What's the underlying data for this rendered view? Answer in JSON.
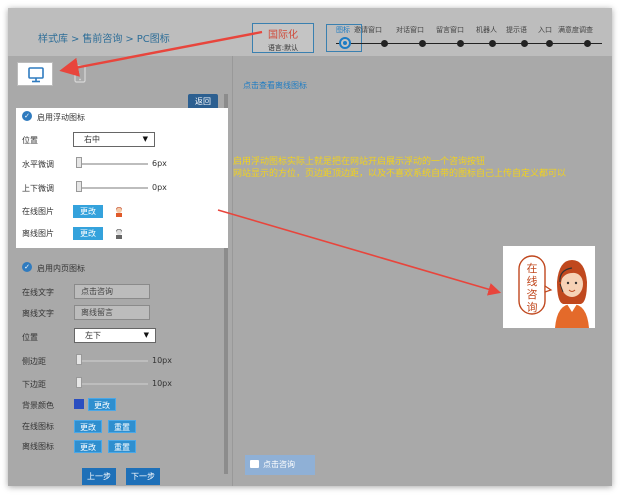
{
  "header": {
    "breadcrumb": [
      "样式库",
      "售前咨询",
      "PC图标"
    ],
    "breadcrumb_sep": ">",
    "intl": {
      "title": "国际化",
      "lang": "语言:默认"
    },
    "steps": [
      "图标",
      "邀请窗口",
      "对话窗口",
      "留言窗口",
      "机器人",
      "提示语",
      "入口",
      "满意度调查"
    ]
  },
  "left": {
    "back_label": "返回",
    "float_section": {
      "title": "启用浮动图标",
      "position_label": "位置",
      "position_value": "右中",
      "h_adjust_label": "水平微调",
      "h_adjust_value": "6px",
      "v_adjust_label": "上下微调",
      "v_adjust_value": "0px",
      "online_img_label": "在线图片",
      "offline_img_label": "离线图片",
      "change_label": "更改"
    },
    "inpage_section": {
      "title": "启用内页图标",
      "online_text_label": "在线文字",
      "online_text_value": "点击咨询",
      "offline_text_label": "离线文字",
      "offline_text_value": "离线留言",
      "position_label": "位置",
      "position_value": "左下",
      "side_margin_label": "侧边距",
      "side_margin_value": "10px",
      "bottom_margin_label": "下边距",
      "bottom_margin_value": "10px",
      "bg_color_label": "背景颜色",
      "bg_color": "#2a4ec0",
      "online_icon_label": "在线图标",
      "offline_icon_label": "离线图标",
      "change_label": "更改",
      "reset_label": "重置"
    },
    "prev_label": "上一步",
    "next_label": "下一步"
  },
  "right": {
    "offline_link": "点击查看离线图标",
    "description_lines": [
      "启用浮动图标实际上就是把在网站开启展示浮动的一个咨询按钮",
      "网站显示的方位，页边距顶边距，以及不喜欢系统自带的图标自己上传自定义都可以"
    ],
    "bubble_text": [
      "在",
      "线",
      "咨",
      "询"
    ],
    "consult_button": "点击咨询"
  },
  "colors": {
    "accent": "#1d7cc4",
    "annotation": "#f2d21c",
    "arrow": "#e8453c"
  }
}
